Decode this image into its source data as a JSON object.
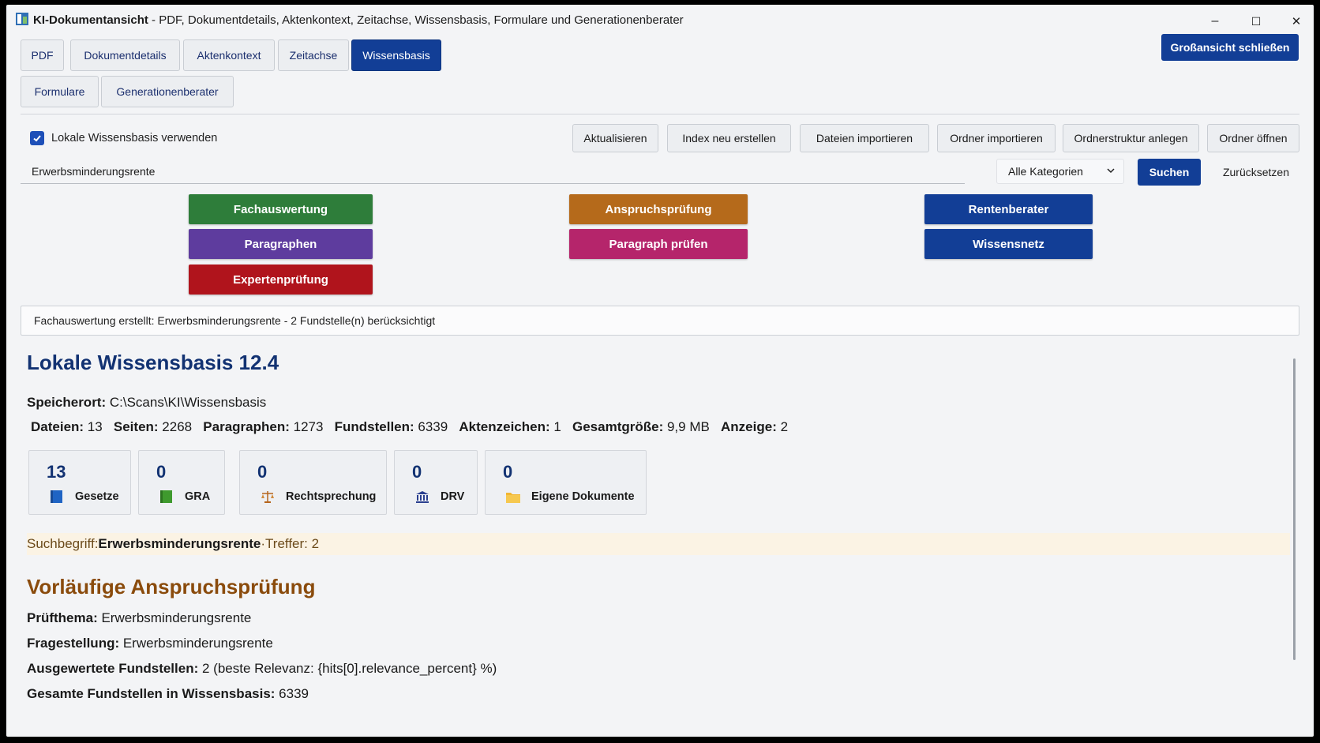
{
  "window": {
    "title_bold": "KI-Dokumentansicht",
    "title_rest": " - PDF, Dokumentdetails, Aktenkontext, Zeitachse, Wissensbasis, Formulare und Generationenberater",
    "minimize": "–",
    "maximize": "☐",
    "close": "✕"
  },
  "tabs": [
    "PDF",
    "Dokumentdetails",
    "Aktenkontext",
    "Zeitachse",
    "Wissensbasis",
    "Formulare",
    "Generationenberater"
  ],
  "active_tab": "Wissensbasis",
  "close_fullscreen_label": "Großansicht schließen",
  "toolbar": {
    "checkbox_label": "Lokale Wissensbasis verwenden",
    "checkbox_checked": true,
    "buttons": [
      "Aktualisieren",
      "Index neu erstellen",
      "Dateien importieren",
      "Ordner importieren",
      "Ordnerstruktur anlegen",
      "Ordner öffnen"
    ]
  },
  "search": {
    "value": "Erwerbsminderungsrente",
    "category": "Alle Kategorien",
    "search_label": "Suchen",
    "reset_label": "Zurücksetzen"
  },
  "feature_buttons": {
    "fachauswertung": {
      "label": "Fachauswertung",
      "color": "#2e7d3a"
    },
    "paragraphen": {
      "label": "Paragraphen",
      "color": "#5e3c9e"
    },
    "expertenpruefung": {
      "label": "Expertenprüfung",
      "color": "#b0141c"
    },
    "anspruchspruefung": {
      "label": "Anspruchsprüfung",
      "color": "#b56a1b"
    },
    "paragraph_pruefen": {
      "label": "Paragraph prüfen",
      "color": "#b5256b"
    },
    "rentenberater": {
      "label": "Rentenberater",
      "color": "#123e96"
    },
    "wissensnetz": {
      "label": "Wissensnetz",
      "color": "#123e96"
    }
  },
  "status": "Fachauswertung erstellt: Erwerbsminderungsrente - 2 Fundstelle(n) berücksichtigt",
  "content": {
    "title": "Lokale Wissensbasis 12.4",
    "location_label": "Speicherort:",
    "location_value": " C:\\Scans\\KI\\Wissensbasis",
    "stats_line": [
      {
        "label": "Dateien:",
        "value": " 13"
      },
      {
        "label": "Seiten:",
        "value": " 2268"
      },
      {
        "label": "Paragraphen:",
        "value": " 1273"
      },
      {
        "label": "Fundstellen:",
        "value": " 6339"
      },
      {
        "label": "Aktenzeichen:",
        "value": " 1"
      },
      {
        "label": "Gesamtgröße:",
        "value": " 9,9 MB"
      },
      {
        "label": "Anzeige:",
        "value": " 2"
      }
    ],
    "cards": [
      {
        "count": "13",
        "label": "Gesetze",
        "icon": "law-book-icon"
      },
      {
        "count": "0",
        "label": "GRA",
        "icon": "green-book-icon"
      },
      {
        "count": "0",
        "label": "Rechtsprechung",
        "icon": "scales-icon"
      },
      {
        "count": "0",
        "label": "DRV",
        "icon": "institution-icon"
      },
      {
        "count": "0",
        "label": "Eigene Dokumente",
        "icon": "folder-icon"
      }
    ],
    "search_banner": {
      "prefix": "Suchbegriff: ",
      "term": "Erwerbsminderungsrente",
      "sep": " · ",
      "hits": "Treffer: 2"
    },
    "section_title": "Vorläufige Anspruchsprüfung",
    "details": [
      {
        "label": "Prüfthema:",
        "value": " Erwerbsminderungsrente"
      },
      {
        "label": "Fragestellung:",
        "value": " Erwerbsminderungsrente"
      },
      {
        "label": "Ausgewertete Fundstellen:",
        "value": " 2 (beste Relevanz: {hits[0].relevance_percent} %)"
      },
      {
        "label": "Gesamte Fundstellen in Wissensbasis:",
        "value": " 6339"
      }
    ]
  }
}
